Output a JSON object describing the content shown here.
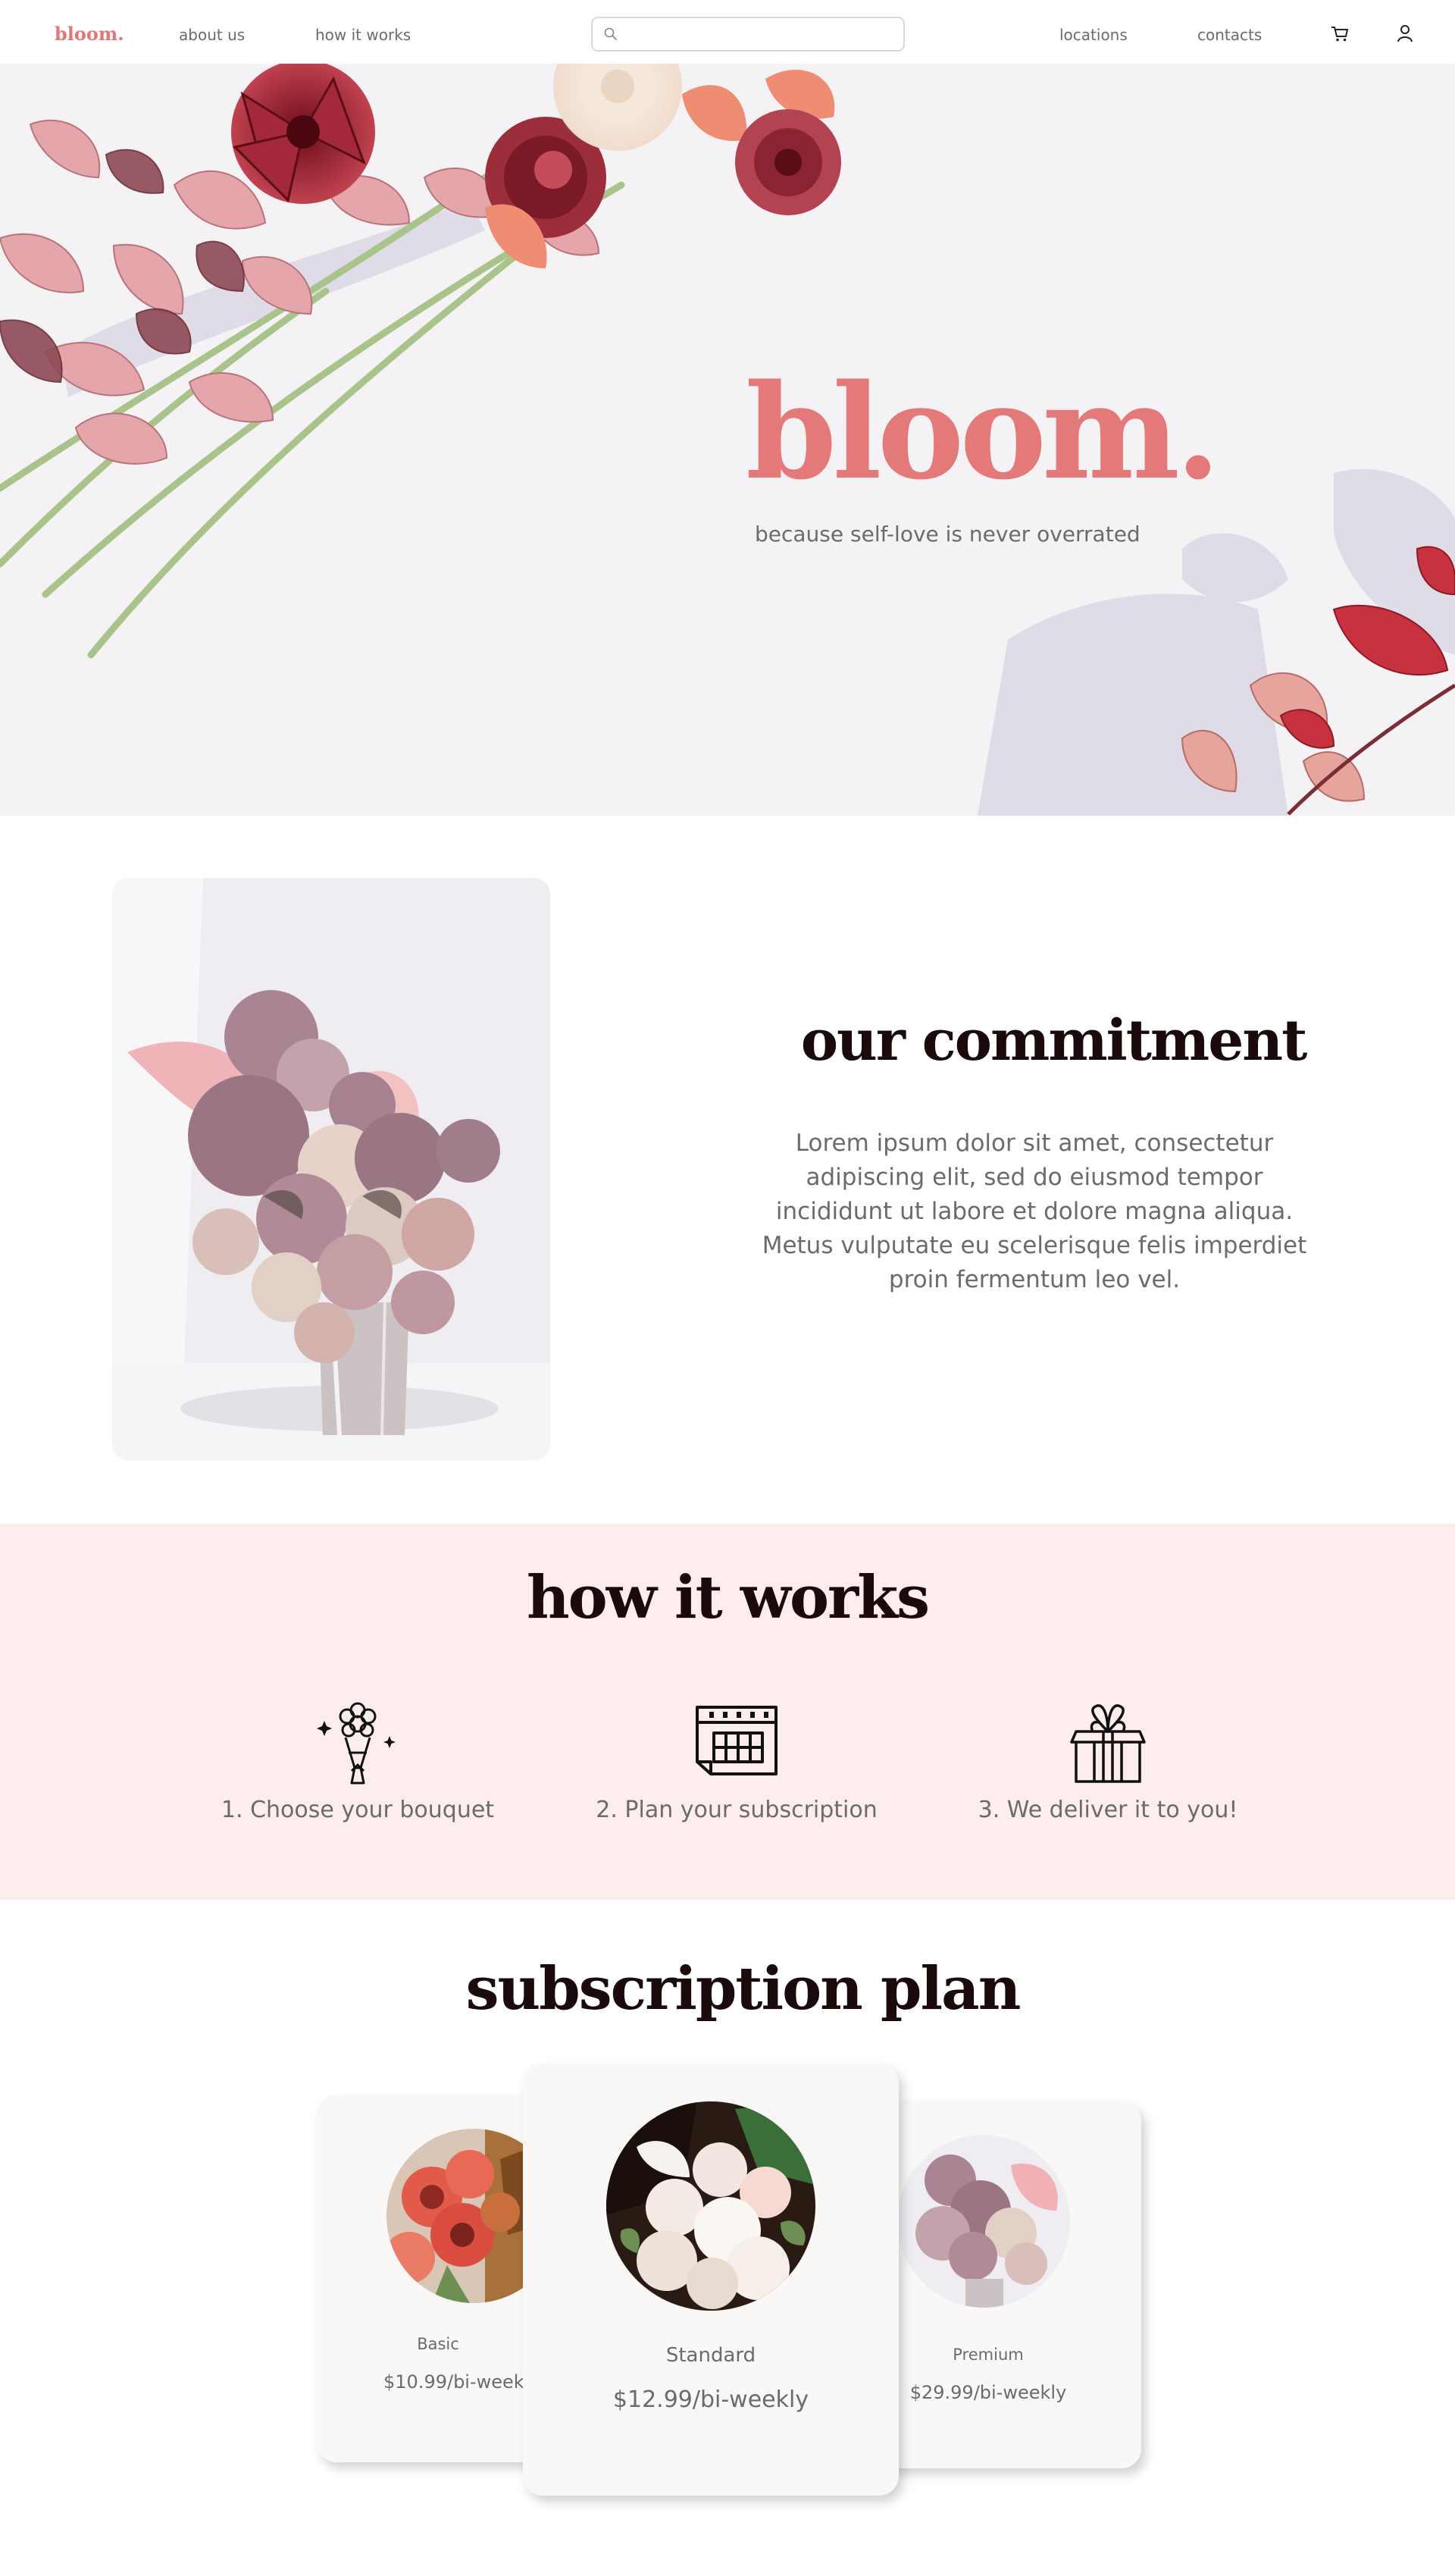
{
  "nav": {
    "logo": "bloom.",
    "about": "about us",
    "how": "how it works",
    "search_placeholder": "",
    "locations": "locations",
    "contacts": "contacts",
    "icons": [
      "search-icon",
      "cart-icon",
      "user-icon"
    ]
  },
  "hero": {
    "title": "bloom.",
    "tagline": "because self-love is never overrated"
  },
  "commitment": {
    "title": "our commitment",
    "body": "Lorem ipsum dolor sit amet, consectetur adipiscing elit, sed do eiusmod tempor incididunt ut labore et dolore magna aliqua. Metus vulputate eu scelerisque felis imperdiet proin fermentum leo vel."
  },
  "how": {
    "title": "how it works",
    "steps": [
      {
        "label": "1. Choose your bouquet",
        "icon": "bouquet-icon"
      },
      {
        "label": "2. Plan your subscription",
        "icon": "calendar-icon"
      },
      {
        "label": "3. We deliver it to you!",
        "icon": "gift-icon"
      }
    ]
  },
  "subscription": {
    "title": "subscription plan",
    "plans": [
      {
        "name": "Basic",
        "price": "$10.99/bi-weekly"
      },
      {
        "name": "Standard",
        "price": "$12.99/bi-weekly"
      },
      {
        "name": "Premium",
        "price": "$29.99/bi-weekly"
      }
    ]
  },
  "colors": {
    "brand": "#e47979",
    "heading": "#1a0a0c",
    "text": "#6b6b6b",
    "how_bg": "#fdeeed",
    "hero_bg": "#f4f2f4"
  }
}
